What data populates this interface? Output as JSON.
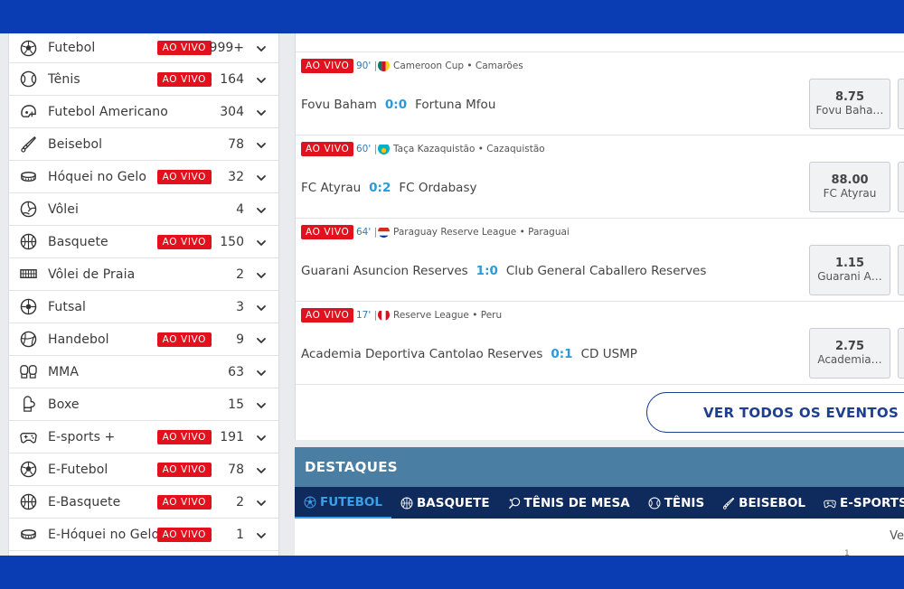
{
  "sidebar": {
    "live_label": "AO VIVO",
    "items": [
      {
        "name": "Futebol",
        "icon": "soccer-ball-icon",
        "live": true,
        "count": "999+"
      },
      {
        "name": "Tênis",
        "icon": "tennis-ball-icon",
        "live": true,
        "count": "164"
      },
      {
        "name": "Futebol Americano",
        "icon": "football-helmet-icon",
        "live": false,
        "count": "304"
      },
      {
        "name": "Beisebol",
        "icon": "baseball-bat-icon",
        "live": false,
        "count": "78"
      },
      {
        "name": "Hóquei no Gelo",
        "icon": "hockey-puck-icon",
        "live": true,
        "count": "32"
      },
      {
        "name": "Vôlei",
        "icon": "volleyball-icon",
        "live": false,
        "count": "4"
      },
      {
        "name": "Basquete",
        "icon": "basketball-icon",
        "live": true,
        "count": "150"
      },
      {
        "name": "Vôlei de Praia",
        "icon": "beach-volley-net-icon",
        "live": false,
        "count": "2"
      },
      {
        "name": "Futsal",
        "icon": "futsal-ball-icon",
        "live": false,
        "count": "3"
      },
      {
        "name": "Handebol",
        "icon": "handball-icon",
        "live": true,
        "count": "9"
      },
      {
        "name": "MMA",
        "icon": "mma-gloves-icon",
        "live": false,
        "count": "63"
      },
      {
        "name": "Boxe",
        "icon": "boxing-glove-icon",
        "live": false,
        "count": "15"
      },
      {
        "name": "E-sports +",
        "icon": "gamepad-icon",
        "live": true,
        "count": "191"
      },
      {
        "name": "E-Futebol",
        "icon": "soccer-ball-icon",
        "live": true,
        "count": "78"
      },
      {
        "name": "E-Basquete",
        "icon": "basketball-icon",
        "live": true,
        "count": "2"
      },
      {
        "name": "E-Hóquei no Gelo",
        "icon": "hockey-puck-icon",
        "live": true,
        "count": "1"
      }
    ]
  },
  "events": [
    {
      "live": "AO VIVO",
      "minute": "90'",
      "flag": "cameroon",
      "league": "Cameroon Cup  •  Camarões",
      "home": "Fovu Baham",
      "score": "0:0",
      "away": "Fortuna Mfou",
      "odd": "8.75",
      "odd_label": "Fovu Baha…"
    },
    {
      "live": "AO VIVO",
      "minute": "60'",
      "flag": "kazakhstan",
      "league": "Taça Kazaquistão  •  Cazaquistão",
      "home": "FC Atyrau",
      "score": "0:2",
      "away": "FC Ordabasy",
      "odd": "88.00",
      "odd_label": "FC Atyrau"
    },
    {
      "live": "AO VIVO",
      "minute": "64'",
      "flag": "paraguay",
      "league": "Paraguay Reserve League  •  Paraguai",
      "home": "Guarani Asuncion Reserves",
      "score": "1:0",
      "away": "Club General Caballero Reserves",
      "odd": "1.15",
      "odd_label": "Guarani A…"
    },
    {
      "live": "AO VIVO",
      "minute": "17'",
      "flag": "peru",
      "league": "Reserve League  •  Peru",
      "home": "Academia Deportiva Cantolao Reserves",
      "score": "0:1",
      "away": "CD USMP",
      "odd": "2.75",
      "odd_label": "Academia…"
    }
  ],
  "all_events_label": "VER TODOS OS EVENTOS",
  "highlights": {
    "title": "DESTAQUES",
    "tabs": [
      {
        "label": "FUTEBOL",
        "icon": "soccer-ball-icon",
        "active": true
      },
      {
        "label": "BASQUETE",
        "icon": "basketball-icon",
        "active": false
      },
      {
        "label": "TÊNIS DE MESA",
        "icon": "table-tennis-icon",
        "active": false
      },
      {
        "label": "TÊNIS",
        "icon": "tennis-ball-icon",
        "active": false
      },
      {
        "label": "BEISEBOL",
        "icon": "baseball-bat-icon",
        "active": false
      },
      {
        "label": "E-SPORTS +",
        "icon": "gamepad-icon",
        "active": false
      }
    ],
    "below_text": "Ve",
    "below_num": "1"
  },
  "colors": {
    "brand_blue": "#0a3cb4",
    "live_red": "#e1121d",
    "score_blue": "#2a9bd8",
    "highlight_bar": "#4a7fa3",
    "tab_bar": "#0f2a5c"
  }
}
